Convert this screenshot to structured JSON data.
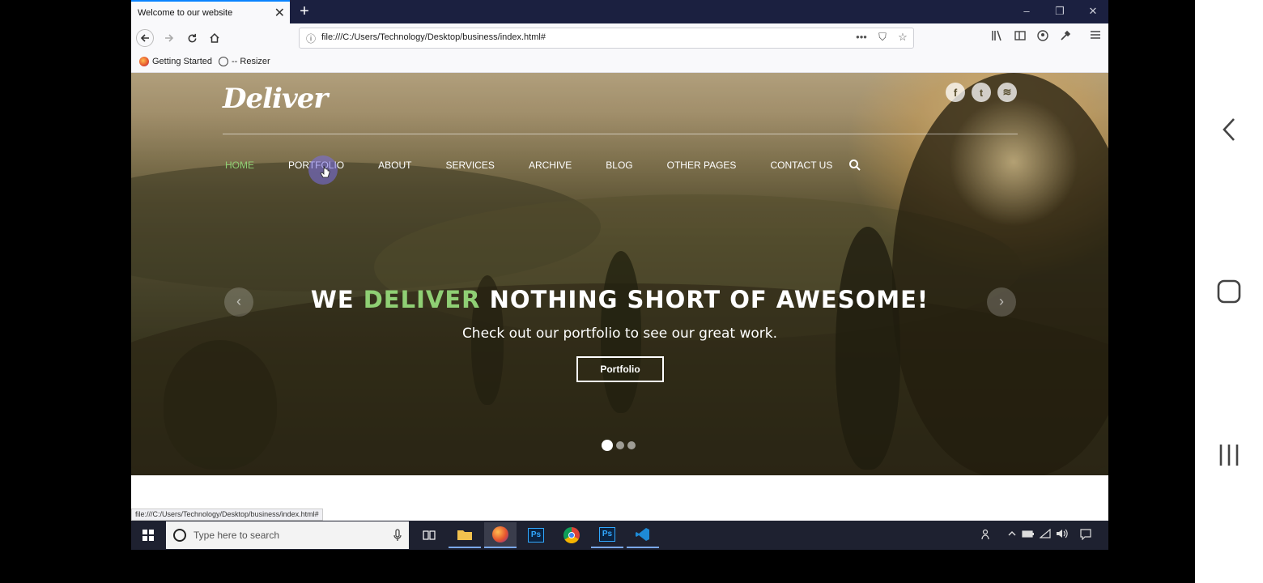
{
  "browser": {
    "tab_title": "Welcome to our website",
    "tab_close": "✕",
    "new_tab": "+",
    "window_controls": {
      "minimize": "–",
      "restore": "❐",
      "close": "✕"
    },
    "url": "file:///C:/Users/Technology/Desktop/business/index.html#",
    "url_actions": {
      "more": "•••",
      "pocket": "⛉",
      "bookmark": "☆"
    },
    "bookmarks": [
      "Getting Started",
      "-- Resizer"
    ],
    "status_url": "file:///C:/Users/Technology/Desktop/business/index.html#"
  },
  "site": {
    "logo": "Deliver",
    "social": [
      {
        "name": "facebook-icon",
        "glyph": "f"
      },
      {
        "name": "twitter-icon",
        "glyph": "t"
      },
      {
        "name": "rss-icon",
        "glyph": "≋"
      }
    ],
    "menu": [
      {
        "label": "HOME",
        "active": true
      },
      {
        "label": "PORTFOLIO",
        "active": false
      },
      {
        "label": "ABOUT",
        "active": false
      },
      {
        "label": "SERVICES",
        "active": false
      },
      {
        "label": "ARCHIVE",
        "active": false
      },
      {
        "label": "BLOG",
        "active": false
      },
      {
        "label": "OTHER PAGES",
        "active": false
      },
      {
        "label": "CONTACT US",
        "active": false
      }
    ],
    "hero": {
      "headline_pre": "WE ",
      "headline_accent": "DELIVER",
      "headline_post": " NOTHING SHORT OF AWESOME!",
      "subline": "Check out our portfolio to see our great work.",
      "button": "Portfolio",
      "prev_arrow": "‹",
      "next_arrow": "›",
      "slide_count": 3,
      "active_slide": 1
    },
    "accent_color": "#8fcf74"
  },
  "taskbar": {
    "search_placeholder": "Type here to search",
    "apps": [
      "task-view",
      "file-explorer",
      "firefox",
      "photoshop",
      "chrome",
      "photoshop-2",
      "vscode"
    ]
  },
  "phone_nav": {
    "back": "back-button",
    "home": "home-button",
    "recents": "recents-button"
  }
}
